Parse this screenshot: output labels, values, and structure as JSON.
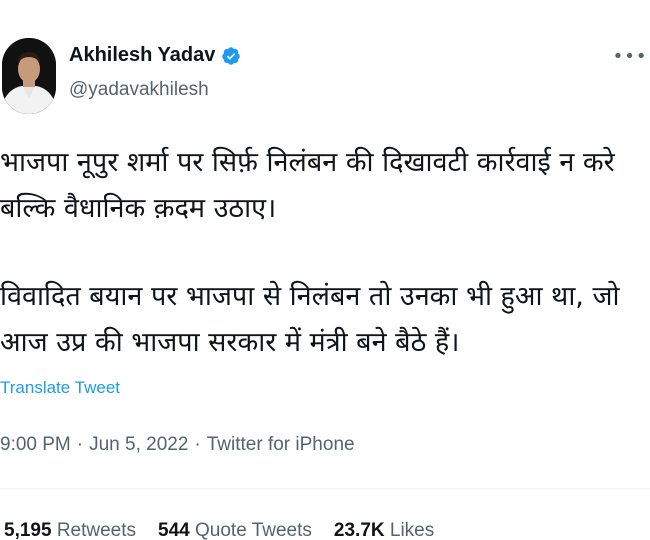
{
  "author": {
    "display_name": "Akhilesh Yadav",
    "handle": "@yadavakhilesh",
    "verified_icon": "verified-badge-icon",
    "more_icon": "more-options-icon"
  },
  "tweet": {
    "paragraph_1": "भाजपा नूपुर शर्मा पर सिर्फ़ निलंबन की दिखावटी कार्रवाई न करे बल्कि वैधानिक क़दम उठाए।",
    "paragraph_2": "विवादित बयान पर भाजपा से निलंबन तो उनका भी हुआ था, जो आज उप्र की भाजपा सरकार में मंत्री बने बैठे हैं।",
    "translate_label": "Translate Tweet"
  },
  "meta": {
    "time": "9:00 PM",
    "sep1": "·",
    "date": "Jun 5, 2022",
    "sep2": "·",
    "source": "Twitter for iPhone"
  },
  "stats": {
    "retweets_count": "5,195",
    "retweets_label": "Retweets",
    "quotes_count": "544",
    "quotes_label": "Quote Tweets",
    "likes_count": "23.7K",
    "likes_label": "Likes"
  },
  "colors": {
    "link": "#1d9bf0",
    "secondary_text": "#536471",
    "primary_text": "#0f1419"
  }
}
